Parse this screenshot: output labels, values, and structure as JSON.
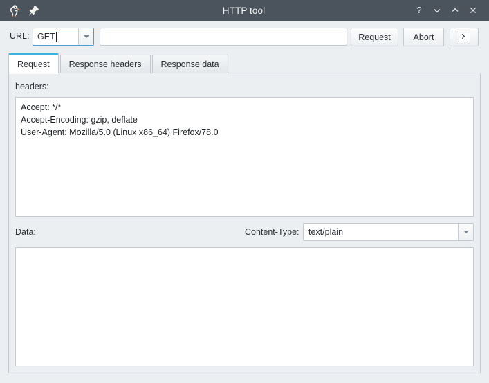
{
  "window": {
    "title": "HTTP tool",
    "app_icon": "goose-icon",
    "pin_icon": "pin-icon",
    "controls": [
      {
        "name": "help-button",
        "glyph": "?"
      },
      {
        "name": "minimize-button",
        "glyph": "v"
      },
      {
        "name": "maximize-button",
        "glyph": "^"
      },
      {
        "name": "close-button",
        "glyph": "x"
      }
    ],
    "titlebar_color": "#4b535c",
    "background_color": "#eceff1",
    "accent_color": "#3daee9",
    "focus_border_color": "#4a9fd8"
  },
  "toolbar": {
    "url_label": "URL:",
    "method_value": "GET",
    "method_focused": true,
    "url_value": "",
    "url_placeholder": "",
    "request_button": "Request",
    "abort_button": "Abort",
    "console_button_icon": "terminal-icon"
  },
  "tabs": [
    {
      "label": "Request",
      "active": true
    },
    {
      "label": "Response headers",
      "active": false
    },
    {
      "label": "Response data",
      "active": false
    }
  ],
  "request_tab": {
    "headers_label": "headers:",
    "headers_value": "Accept: */*\nAccept-Encoding: gzip, deflate\nUser-Agent: Mozilla/5.0 (Linux x86_64) Firefox/78.0",
    "data_label": "Data:",
    "content_type_label": "Content-Type:",
    "content_type_value": "text/plain",
    "data_value": ""
  }
}
